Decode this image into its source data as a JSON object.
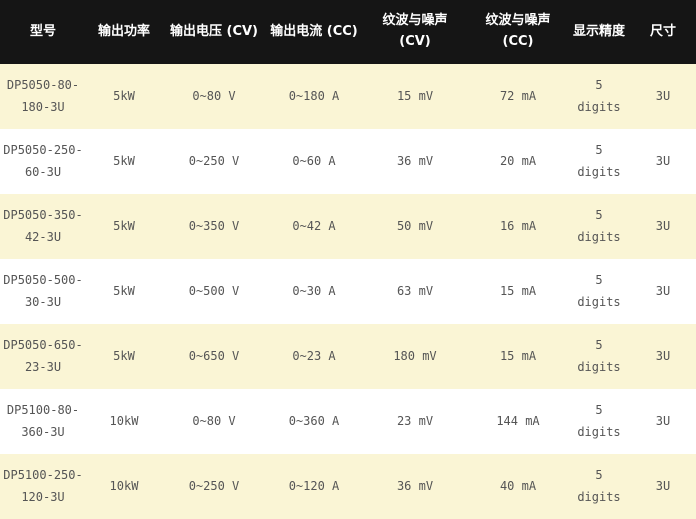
{
  "table": {
    "columns": [
      "型号",
      "输出功率",
      "输出电压 (CV)",
      "输出电流 (CC)",
      "纹波与噪声 (CV)",
      "纹波与噪声 (CC)",
      "显示精度",
      "尺寸"
    ],
    "rows": [
      [
        "DP5050-80-180-3U",
        "5kW",
        "0~80 V",
        "0~180 A",
        "15 mV",
        "72 mA",
        "5 digits",
        "3U"
      ],
      [
        "DP5050-250-60-3U",
        "5kW",
        "0~250 V",
        "0~60 A",
        "36 mV",
        "20 mA",
        "5 digits",
        "3U"
      ],
      [
        "DP5050-350-42-3U",
        "5kW",
        "0~350 V",
        "0~42 A",
        "50 mV",
        "16 mA",
        "5 digits",
        "3U"
      ],
      [
        "DP5050-500-30-3U",
        "5kW",
        "0~500 V",
        "0~30 A",
        "63 mV",
        "15 mA",
        "5 digits",
        "3U"
      ],
      [
        "DP5050-650-23-3U",
        "5kW",
        "0~650 V",
        "0~23 A",
        "180 mV",
        "15 mA",
        "5 digits",
        "3U"
      ],
      [
        "DP5100-80-360-3U",
        "10kW",
        "0~80 V",
        "0~360 A",
        "23 mV",
        "144 mA",
        "5 digits",
        "3U"
      ],
      [
        "DP5100-250-120-3U",
        "10kW",
        "0~250 V",
        "0~120 A",
        "36 mV",
        "40 mA",
        "5 digits",
        "3U"
      ]
    ],
    "colors": {
      "header_bg": "#151515",
      "header_text": "#ffffff",
      "row_odd_bg": "#faf5d5",
      "row_even_bg": "#ffffff",
      "body_text": "#555555"
    }
  }
}
